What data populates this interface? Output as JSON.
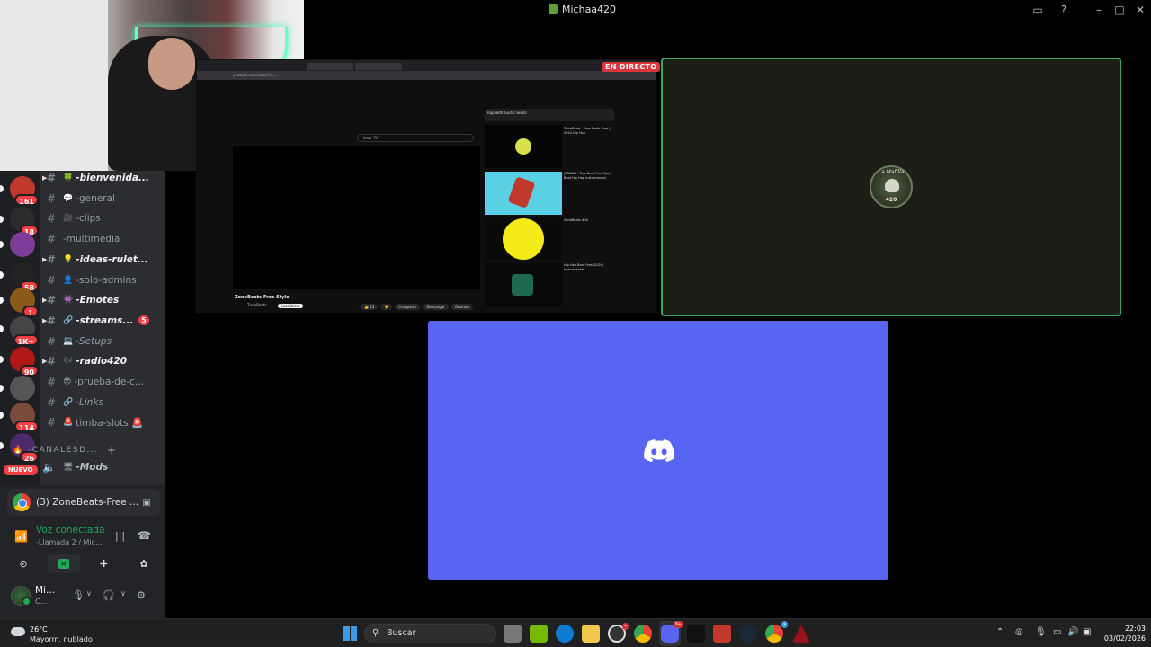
{
  "window": {
    "title": "Michaa420",
    "controls": [
      "inbox-icon",
      "help-icon",
      "minimize",
      "maximize",
      "close"
    ]
  },
  "servers": [
    {
      "icon": "server-red",
      "badge": "161",
      "color": "#c0392b"
    },
    {
      "icon": "server-green",
      "badge": "18",
      "color": "#2b2b2b"
    },
    {
      "icon": "server-purple",
      "badge": "",
      "color": "#7d3c98"
    },
    {
      "icon": "server-caos",
      "badge": "58",
      "color": "#222"
    },
    {
      "icon": "server-caos2",
      "badge": "1",
      "color": "#8a5a1a"
    },
    {
      "icon": "server-dark",
      "badge": "1K+",
      "color": "#444"
    },
    {
      "icon": "server-red2",
      "badge": "90",
      "color": "#b01818"
    },
    {
      "icon": "server-grey",
      "badge": "",
      "color": "#555"
    },
    {
      "icon": "server-brown",
      "badge": "114",
      "color": "#7a4a3a"
    },
    {
      "icon": "server-violet",
      "badge": "26",
      "color": "#4a2a6a"
    }
  ],
  "new_label": "NUEVO",
  "channels": [
    {
      "emoji": "🍀",
      "name": "-bienvenida...",
      "unread": true,
      "caret": true
    },
    {
      "emoji": "💬",
      "name": "-general",
      "unread": false,
      "caret": false
    },
    {
      "emoji": "🎥",
      "name": "-clips",
      "unread": false,
      "caret": false
    },
    {
      "emoji": "",
      "name": "-multimedia",
      "unread": false,
      "caret": false
    },
    {
      "emoji": "💡",
      "name": "-ideas-rulet...",
      "unread": true,
      "caret": true
    },
    {
      "emoji": "👤",
      "name": "-solo-admins",
      "unread": false,
      "caret": false
    },
    {
      "emoji": "👾",
      "name": "-Emotes",
      "unread": true,
      "caret": true
    },
    {
      "emoji": "🔗",
      "name": "-streams...",
      "unread": true,
      "caret": true,
      "badge": "5"
    },
    {
      "emoji": "💻",
      "name": "-Setups",
      "unread": false,
      "caret": false
    },
    {
      "emoji": "🎶",
      "name": "-radio420",
      "unread": true,
      "caret": true
    },
    {
      "emoji": "😎",
      "name": "-prueba-de-c...",
      "unread": false,
      "caret": false
    },
    {
      "emoji": "🔗",
      "name": "-Links",
      "unread": false,
      "caret": false
    },
    {
      "emoji": "🚨",
      "name": "timba-slots 🚨",
      "unread": false,
      "caret": false
    }
  ],
  "category": "-CANALESD...",
  "voice_channel": {
    "name": "-Mods"
  },
  "stream_card": {
    "label": "(3) ZoneBeats-Free ..."
  },
  "voice": {
    "status": "Voz conectada",
    "sub": "-Llamada 2 / Mic..."
  },
  "user": {
    "name": "Mi...",
    "status": "C..."
  },
  "stage": {
    "live_label": "EN DIRECTO",
    "mafia_logo_top": "La Mafilla",
    "mafia_logo_bottom": "420"
  },
  "screenshare": {
    "url": "youtube.com/watch?v=...",
    "search": "beat \"Fin\"",
    "video_title": "ZoneBeats-Free Style",
    "channel": "ZoneBeats",
    "subscribe": "Suscribirse",
    "buttons": [
      "👍 13",
      "👎",
      "Compartir",
      "Descargar",
      "Guardar"
    ],
    "playlist_header": "Rap with Guitar Beats",
    "playlist": [
      {
        "title": "ZoneBeats - Free Beats Trap | 2024 Hip Hop",
        "meta": "ZoneBeats"
      },
      {
        "title": "JORDAN - Trap Beat Free Type Beat Hip Hop Instrumental",
        "meta": "ZoneBeats"
      },
      {
        "title": "ZoneBeats #10",
        "meta": "ZoneBeats"
      },
      {
        "title": "Hip Hop Beat Free (2024) Instrumental",
        "meta": "ZoneBeats"
      }
    ]
  },
  "taskbar": {
    "temp": "26°C",
    "weather": "Mayorm. nublado",
    "search": "Buscar",
    "time": "22:03",
    "date": "03/02/2026"
  }
}
